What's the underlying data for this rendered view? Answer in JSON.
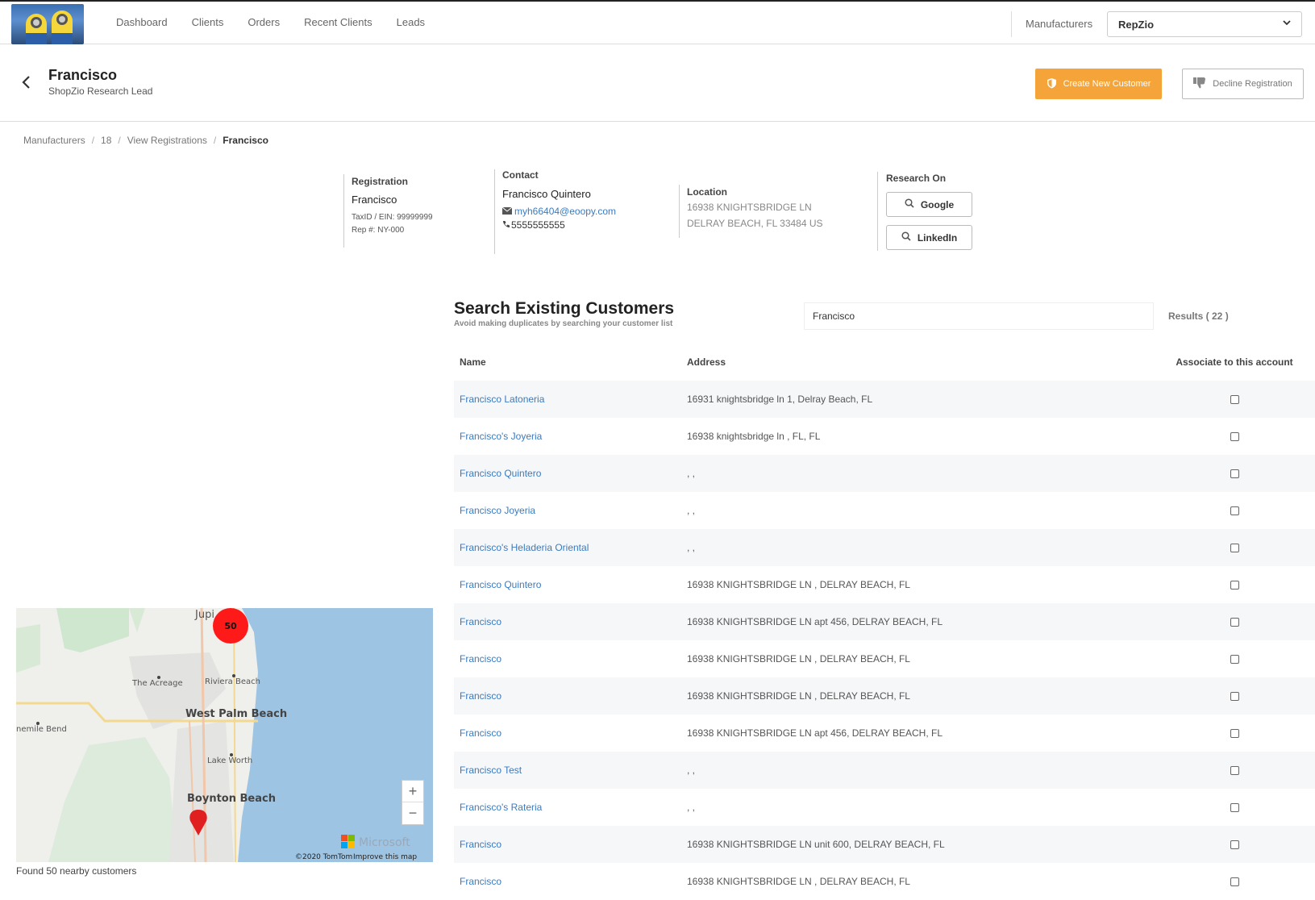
{
  "nav": {
    "items": [
      "Dashboard",
      "Clients",
      "Orders",
      "Recent Clients",
      "Leads"
    ],
    "manufacturers_label": "Manufacturers",
    "manufacturer_selected": "RepZio"
  },
  "header": {
    "title": "Francisco",
    "subtitle": "ShopZio Research Lead",
    "create_label": "Create New Customer",
    "decline_label": "Decline Registration"
  },
  "breadcrumb": {
    "items": [
      "Manufacturers",
      "18",
      "View Registrations"
    ],
    "current": "Francisco"
  },
  "registration": {
    "label": "Registration",
    "name": "Francisco",
    "tax": "TaxID / EIN: 99999999",
    "rep": "Rep #: NY-000"
  },
  "contact": {
    "label": "Contact",
    "name": "Francisco Quintero",
    "email": "myh66404@eoopy.com",
    "phone": "5555555555"
  },
  "location": {
    "label": "Location",
    "line1": "16938 KNIGHTSBRIDGE LN",
    "line2": "DELRAY BEACH, FL 33484 US"
  },
  "research": {
    "label": "Research On",
    "google": "Google",
    "linkedin": "LinkedIn"
  },
  "search": {
    "title": "Search Existing Customers",
    "subtitle": "Avoid making duplicates by searching your customer list",
    "value": "Francisco",
    "results": "Results ( 22 )"
  },
  "table": {
    "headers": {
      "name": "Name",
      "address": "Address",
      "associate": "Associate to this account"
    },
    "rows": [
      {
        "name": "Francisco Latoneria",
        "address": "16931 knightsbridge ln 1, Delray Beach, FL"
      },
      {
        "name": "Francisco's Joyeria",
        "address": "16938 knightsbridge ln , FL, FL"
      },
      {
        "name": "Francisco Quintero",
        "address": ", ,"
      },
      {
        "name": "Francisco Joyeria",
        "address": ", ,"
      },
      {
        "name": "Francisco's Heladeria Oriental",
        "address": ", ,"
      },
      {
        "name": "Francisco Quintero",
        "address": "16938 KNIGHTSBRIDGE LN , DELRAY BEACH, FL"
      },
      {
        "name": "Francisco",
        "address": "16938 KNIGHTSBRIDGE LN apt 456, DELRAY BEACH, FL"
      },
      {
        "name": "Francisco",
        "address": "16938 KNIGHTSBRIDGE LN , DELRAY BEACH, FL"
      },
      {
        "name": "Francisco",
        "address": "16938 KNIGHTSBRIDGE LN , DELRAY BEACH, FL"
      },
      {
        "name": "Francisco",
        "address": "16938 KNIGHTSBRIDGE LN apt 456, DELRAY BEACH, FL"
      },
      {
        "name": "Francisco Test",
        "address": ", ,"
      },
      {
        "name": "Francisco's Rateria",
        "address": ", ,"
      },
      {
        "name": "Francisco",
        "address": "16938 KNIGHTSBRIDGE LN unit 600, DELRAY BEACH, FL"
      },
      {
        "name": "Francisco",
        "address": "16938 KNIGHTSBRIDGE LN , DELRAY BEACH, FL"
      }
    ]
  },
  "map": {
    "cluster_count": "50",
    "labels": {
      "jupiter": "Jupi",
      "acreage": "The Acreage",
      "riviera": "Riviera Beach",
      "wpb": "West Palm Beach",
      "indiantown": "nemile Bend",
      "lakeworth": "Lake Worth",
      "boynton": "Boynton Beach"
    },
    "attribution": "©2020 TomTom",
    "improve": "Improve this map",
    "brand": "Microsoft",
    "caption": "Found 50 nearby customers"
  },
  "colors": {
    "accent": "#f5a43a",
    "link": "#3b7bbf",
    "marker": "#e02020"
  }
}
